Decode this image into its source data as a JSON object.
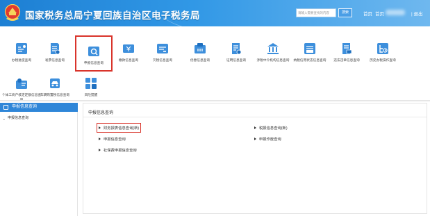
{
  "header": {
    "title": "国家税务总局宁夏回族自治区电子税务局",
    "search_placeholder": "请输入需要查找的内容",
    "search_button": "搜索",
    "nav_home": "首页",
    "nav_home2": "首页",
    "logout": "| 退出",
    "emblem_icon": "tax-emblem-icon"
  },
  "tiles": [
    {
      "label": "办税进度查询",
      "icon": "progress-icon",
      "color": "#3d8fdc"
    },
    {
      "label": "发票信息查询",
      "icon": "invoice-icon",
      "color": "#3d8fdc"
    },
    {
      "label": "申报信息查询",
      "icon": "declaration-search-icon",
      "color": "#3d8fdc"
    },
    {
      "label": "缴款信息查询",
      "icon": "payment-icon",
      "color": "#3d8fdc"
    },
    {
      "label": "欠税信息查询",
      "icon": "arrears-icon",
      "color": "#3d8fdc"
    },
    {
      "label": "优惠信息查询",
      "icon": "preferential-icon",
      "color": "#3d8fdc"
    },
    {
      "label": "证明信息查询",
      "icon": "certificate-icon",
      "color": "#3d8fdc"
    },
    {
      "label": "涉税中介机构信息查询",
      "icon": "agency-bank-icon",
      "color": "#3d8fdc"
    },
    {
      "label": "纳税信用状态信息查询",
      "icon": "credit-icon",
      "color": "#3d8fdc"
    },
    {
      "label": "违法违章信息查询",
      "icon": "violation-icon",
      "color": "#3d8fdc"
    },
    {
      "label": "历史办税操作查询",
      "icon": "history-icon",
      "color": "#3d8fdc"
    },
    {
      "label": "个体工商户核定定额信息查询",
      "icon": "individual-business-icon",
      "color": "#3d8fdc"
    },
    {
      "label": "车辆购置税信息查询",
      "icon": "vehicle-tax-icon",
      "color": "#3d8fdc"
    },
    {
      "label": "风险提醒",
      "icon": "risk-icon",
      "color": "#3d8fdc"
    }
  ],
  "sidebar": {
    "heading": "申报信息查询",
    "items": [
      {
        "label": "申报信息查询"
      }
    ]
  },
  "content": {
    "title": "申报信息查询",
    "links": [
      {
        "label": "财务报表信息查询(新)"
      },
      {
        "label": "税报信息查询(新)"
      },
      {
        "label": "申报信息查询"
      },
      {
        "label": "申报作废查询"
      },
      {
        "label": "社保费申报信息查询"
      }
    ]
  },
  "colors": {
    "accent": "#2f86d8",
    "highlight": "#d9342b",
    "header_start": "#1d7fd3",
    "header_end": "#6fb8ef"
  }
}
